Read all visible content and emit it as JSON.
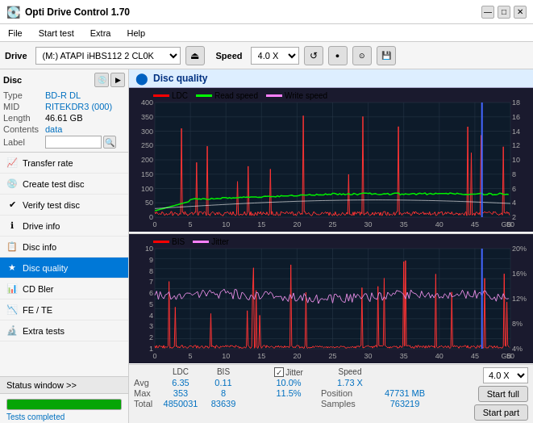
{
  "titlebar": {
    "title": "Opti Drive Control 1.70",
    "icon": "⬛",
    "min_btn": "—",
    "max_btn": "□",
    "close_btn": "✕"
  },
  "menubar": {
    "items": [
      "File",
      "Start test",
      "Extra",
      "Help"
    ]
  },
  "toolbar": {
    "drive_label": "Drive",
    "drive_value": "(M:)  ATAPI iHBS112  2 CL0K",
    "eject_icon": "⏏",
    "speed_label": "Speed",
    "speed_value": "4.0 X",
    "refresh_icon": "↺",
    "icon1": "🖫",
    "icon2": "⬤",
    "save_icon": "💾"
  },
  "disc": {
    "title": "Disc",
    "type_label": "Type",
    "type_value": "BD-R DL",
    "mid_label": "MID",
    "mid_value": "RITEKDR3 (000)",
    "length_label": "Length",
    "length_value": "46.61 GB",
    "contents_label": "Contents",
    "contents_value": "data",
    "label_label": "Label",
    "label_value": ""
  },
  "nav": {
    "items": [
      {
        "id": "transfer-rate",
        "label": "Transfer rate",
        "icon": "📈"
      },
      {
        "id": "create-test-disc",
        "label": "Create test disc",
        "icon": "💿"
      },
      {
        "id": "verify-test-disc",
        "label": "Verify test disc",
        "icon": "✔"
      },
      {
        "id": "drive-info",
        "label": "Drive info",
        "icon": "ℹ"
      },
      {
        "id": "disc-info",
        "label": "Disc info",
        "icon": "📋"
      },
      {
        "id": "disc-quality",
        "label": "Disc quality",
        "icon": "★",
        "active": true
      },
      {
        "id": "cd-bler",
        "label": "CD Bler",
        "icon": "📊"
      },
      {
        "id": "fe-te",
        "label": "FE / TE",
        "icon": "📉"
      },
      {
        "id": "extra-tests",
        "label": "Extra tests",
        "icon": "🔬"
      }
    ]
  },
  "status_window_btn": "Status window >>",
  "progress": {
    "percent": 100,
    "label": "Tests completed"
  },
  "disc_quality": {
    "title": "Disc quality",
    "legend_top": [
      {
        "label": "LDC",
        "color": "#ff0000"
      },
      {
        "label": "Read speed",
        "color": "#00ff00"
      },
      {
        "label": "Write speed",
        "color": "#ff80ff"
      }
    ],
    "legend_bottom": [
      {
        "label": "BIS",
        "color": "#ff0000"
      },
      {
        "label": "Jitter",
        "color": "#ff80ff"
      }
    ],
    "top_chart": {
      "y_max": 400,
      "y_right_max": 18,
      "y_right_labels": [
        18,
        16,
        14,
        12,
        10,
        8,
        6,
        4,
        2
      ],
      "x_max": 50,
      "x_labels": [
        0,
        5,
        10,
        15,
        20,
        25,
        30,
        35,
        40,
        45,
        50
      ]
    },
    "bottom_chart": {
      "y_max": 10,
      "y_right_max": 20,
      "y_right_labels": [
        20,
        16,
        12,
        8,
        4
      ],
      "x_max": 50,
      "x_labels": [
        0,
        5,
        10,
        15,
        20,
        25,
        30,
        35,
        40,
        45,
        50
      ]
    }
  },
  "stats": {
    "headers": [
      "",
      "LDC",
      "BIS",
      "",
      "Jitter",
      "Speed",
      ""
    ],
    "avg_label": "Avg",
    "avg_ldc": "6.35",
    "avg_bis": "0.11",
    "avg_jitter": "10.0%",
    "avg_speed": "1.73 X",
    "avg_speed_combo": "4.0 X",
    "max_label": "Max",
    "max_ldc": "353",
    "max_bis": "8",
    "max_jitter": "11.5%",
    "position_label": "Position",
    "position_value": "47731 MB",
    "total_label": "Total",
    "total_ldc": "4850031",
    "total_bis": "83639",
    "samples_label": "Samples",
    "samples_value": "763219",
    "jitter_checked": true,
    "jitter_label": "Jitter",
    "start_full_label": "Start full",
    "start_part_label": "Start part"
  }
}
